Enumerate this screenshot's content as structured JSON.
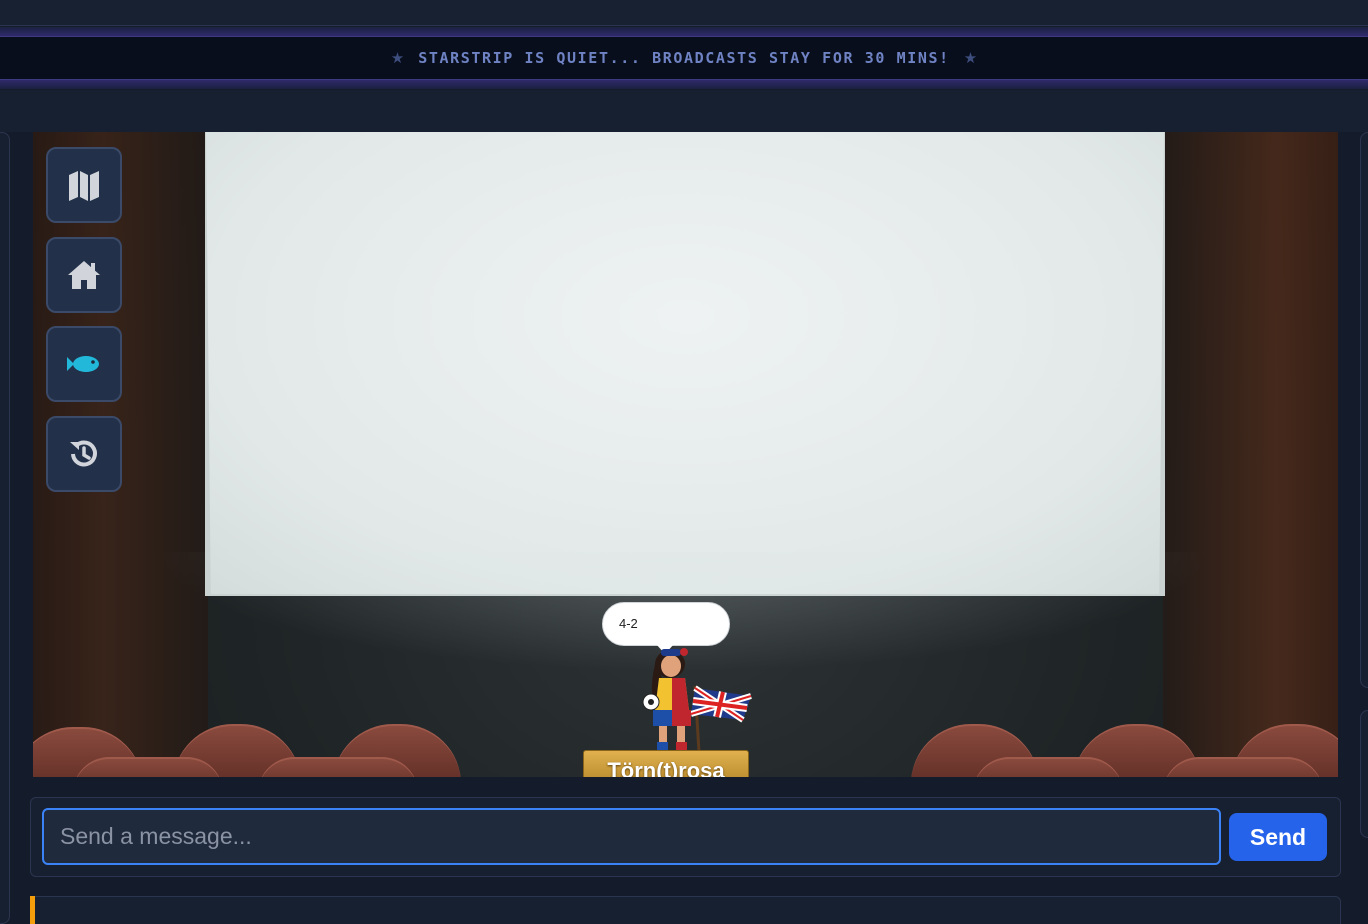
{
  "ticker": {
    "text": "STARSTRIP IS QUIET... BROADCASTS STAY FOR 30 MINS!",
    "star_left": "★",
    "star_right": "★"
  },
  "toolbar": {
    "buttons": [
      {
        "icon": "map-icon",
        "color": "#d1d5db"
      },
      {
        "icon": "home-icon",
        "color": "#d1d5db"
      },
      {
        "icon": "fish-icon",
        "color": "#22b8d9"
      },
      {
        "icon": "history-icon",
        "color": "#d1d5db"
      }
    ]
  },
  "avatar": {
    "speech": "4-2",
    "name": "Törn(t)rosa"
  },
  "chat": {
    "placeholder": "Send a message...",
    "value": "",
    "send_label": "Send"
  },
  "colors": {
    "accent": "#3b82f6",
    "send_button": "#2563eb",
    "log_accent": "#f59e0b"
  }
}
